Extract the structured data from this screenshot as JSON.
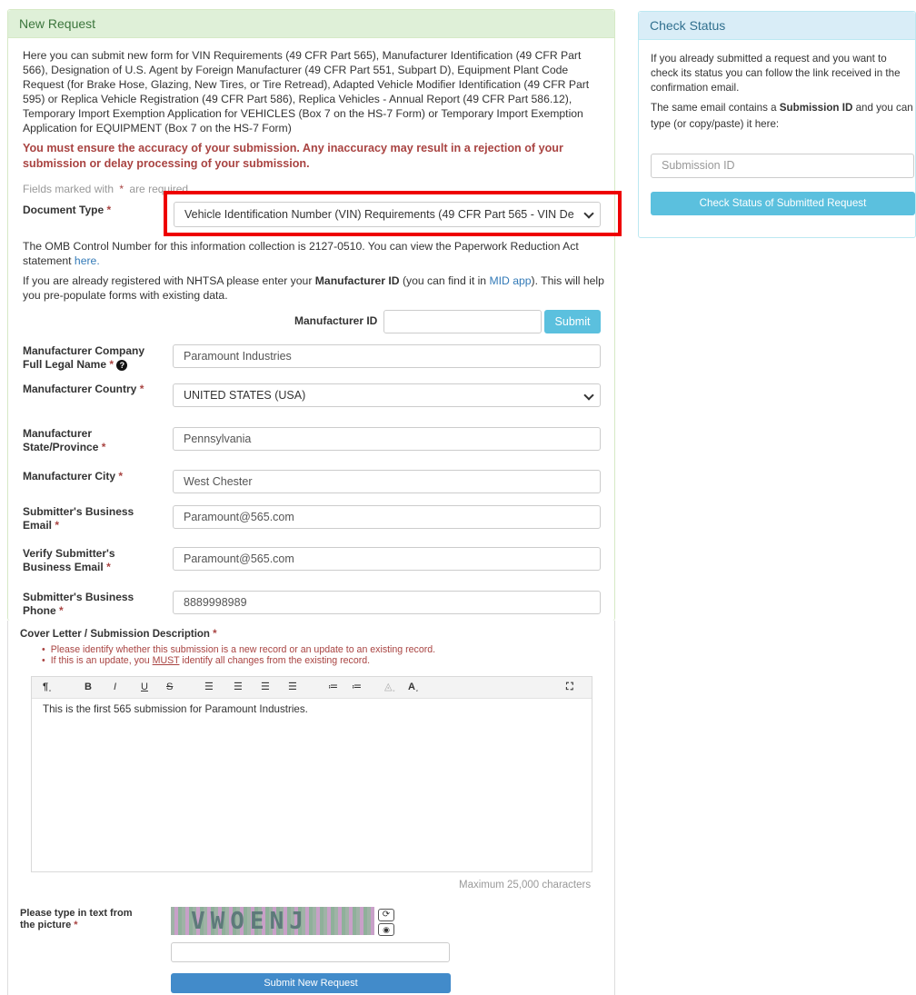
{
  "new_request": {
    "heading": "New Request",
    "intro": "Here you can submit new form for VIN Requirements (49 CFR Part 565), Manufacturer Identification (49 CFR Part 566), Designation of U.S. Agent by Foreign Manufacturer (49 CFR Part 551, Subpart D), Equipment Plant Code Request (for Brake Hose, Glazing, New Tires, or Tire Retread), Adapted Vehicle Modifier Identification (49 CFR Part 595) or Replica Vehicle Registration (49 CFR Part 586), Replica Vehicles - Annual Report (49 CFR Part 586.12), Temporary Import Exemption Application for VEHICLES (Box 7 on the HS-7 Form) or Temporary Import Exemption Application for EQUIPMENT (Box 7 on the HS-7 Form)",
    "warning": "You must ensure the accuracy of your submission. Any inaccuracy may result in a rejection of your submission or delay processing of your submission.",
    "required_note_pre": "Fields marked with",
    "required_star": "*",
    "required_note_post": "are required",
    "document_type_label": "Document Type",
    "document_type_value": "Vehicle Identification Number (VIN) Requirements (49 CFR Part 565 - VIN De",
    "omb_text": "The OMB Control Number for this information collection is 2127-0510. You can view the Paperwork Reduction Act statement",
    "omb_link": "here.",
    "mid_text_1": "If you are already registered with NHTSA please enter your",
    "mid_text_bold": "Manufacturer ID",
    "mid_text_2": "(you can find it in",
    "mid_link": "MID app",
    "mid_text_3": "). This will help you pre-populate forms with existing data.",
    "manufacturer_id_label": "Manufacturer ID",
    "manufacturer_id_value": "",
    "submit_label": "Submit",
    "fields": {
      "company_label": "Manufacturer Company Full Legal Name",
      "company_value": "Paramount Industries",
      "country_label": "Manufacturer Country",
      "country_value": "UNITED STATES (USA)",
      "state_label": "Manufacturer State/Province",
      "state_value": "Pennsylvania",
      "city_label": "Manufacturer City",
      "city_value": "West Chester",
      "email_label": "Submitter's Business Email",
      "email_value": "Paramount@565.com",
      "verify_label": "Verify Submitter's Business Email",
      "verify_value": "Paramount@565.com",
      "phone_label": "Submitter's Business Phone",
      "phone_value": "8889998989"
    }
  },
  "cover_letter": {
    "label": "Cover Letter / Submission Description",
    "bullets": [
      "Please identify whether this submission is a new record or an update to an existing record.",
      "If this is an update, you MUST identify all changes from the existing record."
    ],
    "editor_text": "This is the first 565 submission for Paramount Industries.",
    "max_chars": "Maximum 25,000 characters",
    "toolbar_icons": [
      "paragraph-icon",
      "bold-icon",
      "italic-icon",
      "underline-icon",
      "strikethrough-icon",
      "align-left-icon",
      "align-center-icon",
      "align-right-icon",
      "justify-icon",
      "bullet-list-icon",
      "numbered-list-icon",
      "highlight-color-icon",
      "font-color-icon",
      "fullscreen-icon"
    ]
  },
  "captcha": {
    "label": "Please type in text from the picture",
    "image_text": "VWOENJ",
    "value": "",
    "submit_label": "Submit New Request"
  },
  "check_status": {
    "heading": "Check Status",
    "text1": "If you already submitted a request and you want to check its status you can follow the link received in the confirmation email.",
    "text2_pre": "The same email contains a",
    "text2_bold": "Submission ID",
    "text2_post": "and you can type (or copy/paste) it here:",
    "submission_placeholder": "Submission ID",
    "button_label": "Check Status of Submitted Request"
  },
  "colors": {
    "success_bg": "#dff0d8",
    "info_bg": "#d9edf7",
    "danger": "#a94442",
    "info_button": "#5bc0de",
    "primary_button": "#428bca",
    "highlight": "#ee0000"
  }
}
